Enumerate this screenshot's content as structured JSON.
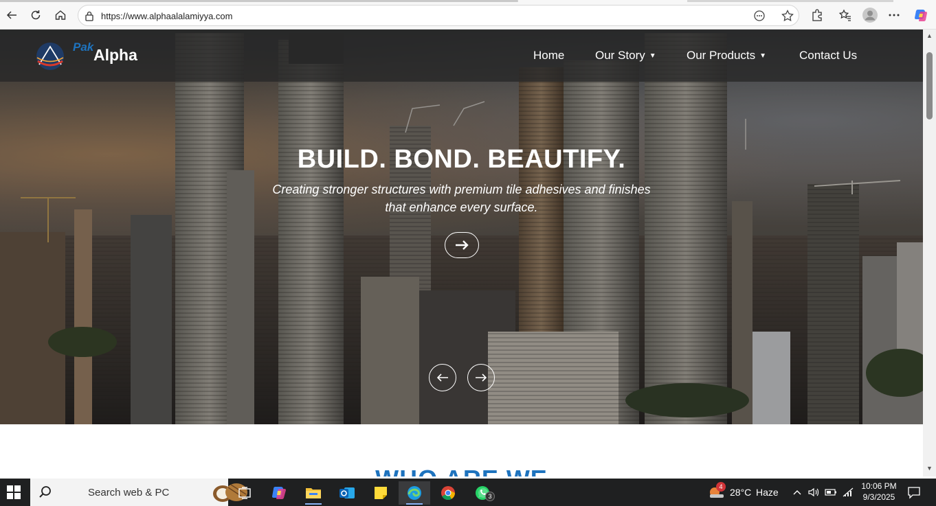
{
  "browser": {
    "url": "https://www.alphaalalamiyya.com"
  },
  "site": {
    "logo_top": "Pak",
    "logo_main": "Alpha",
    "nav": [
      {
        "label": "Home"
      },
      {
        "label": "Our Story",
        "has_dropdown": true
      },
      {
        "label": "Our Products",
        "has_dropdown": true
      },
      {
        "label": "Contact Us"
      }
    ],
    "hero_title": "BUILD. BOND. BEAUTIFY.",
    "hero_subtitle_line1": "Creating stronger structures with premium tile adhesives and finishes",
    "hero_subtitle_line2": "that enhance every surface.",
    "next_section_heading": "WHO ARE WE",
    "accent_color": "#1e73be"
  },
  "taskbar": {
    "search_placeholder": "Search web & PC",
    "weather_temp": "28°C",
    "weather_desc": "Haze",
    "weather_badge": "4",
    "whatsapp_badge": "3",
    "time": "10:06 PM",
    "date": "9/3/2025"
  },
  "icons": {
    "toolbar": [
      "back-icon",
      "refresh-icon",
      "home-icon",
      "lock-icon",
      "read-aloud-icon",
      "favorite-star-icon",
      "extensions-icon",
      "favorites-icon",
      "profile-icon",
      "more-icon",
      "copilot-icon"
    ],
    "taskbar": [
      "windows-start-icon",
      "search-icon",
      "task-view-icon",
      "copilot-app-icon",
      "file-explorer-icon",
      "outlook-icon",
      "sticky-notes-icon",
      "edge-icon",
      "chrome-icon",
      "whatsapp-icon"
    ]
  }
}
